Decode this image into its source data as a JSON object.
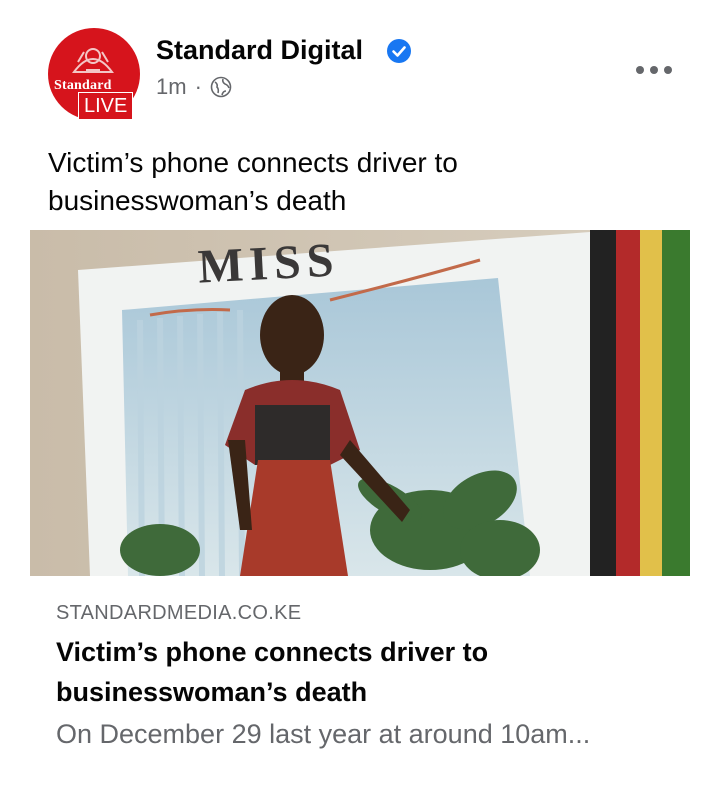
{
  "post": {
    "page_name": "Standard Digital",
    "verified_icon": "verified-badge-icon",
    "time": "1m",
    "separator": "·",
    "audience_icon": "globe-icon",
    "more_icon": "more-options-icon",
    "text": "Victim’s phone connects driver to businesswoman’s death"
  },
  "avatar": {
    "brand": "Standard",
    "badge": "LIVE",
    "color": "#d6141c"
  },
  "photo": {
    "poster_heading": "MISS"
  },
  "link_preview": {
    "domain": "STANDARDMEDIA.CO.KE",
    "title": "Victim’s phone connects driver to businesswoman’s death",
    "description": "On December 29 last year at around 10am..."
  },
  "colors": {
    "accent": "#1877f2",
    "secondary_text": "#65676b",
    "primary_text": "#050505"
  }
}
